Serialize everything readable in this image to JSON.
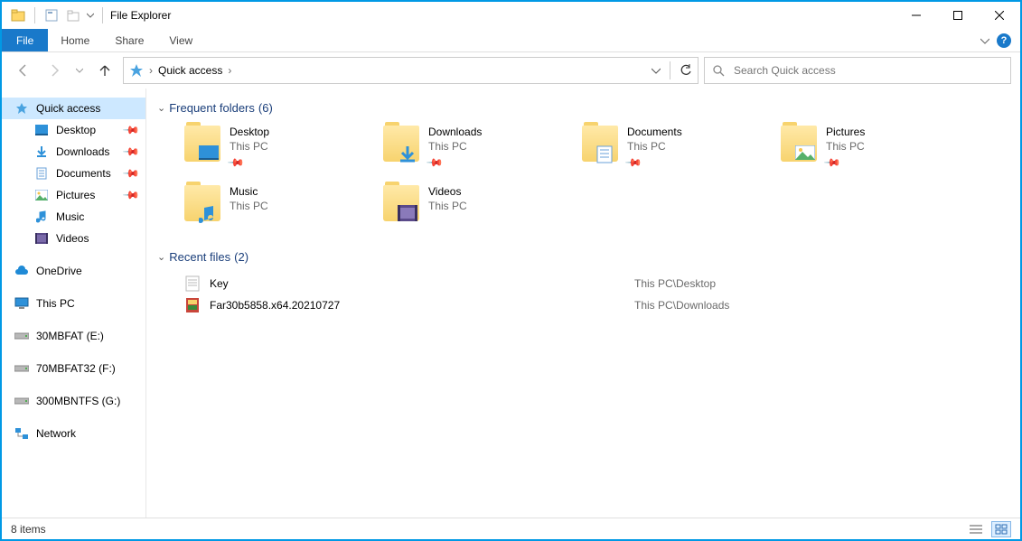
{
  "window": {
    "title": "File Explorer"
  },
  "ribbon": {
    "file": "File",
    "tabs": [
      "Home",
      "Share",
      "View"
    ]
  },
  "breadcrumb": {
    "root": "Quick access"
  },
  "search": {
    "placeholder": "Search Quick access"
  },
  "sidebar": {
    "quick_access": "Quick access",
    "pinned": [
      {
        "label": "Desktop",
        "icon": "desktop"
      },
      {
        "label": "Downloads",
        "icon": "download"
      },
      {
        "label": "Documents",
        "icon": "document"
      },
      {
        "label": "Pictures",
        "icon": "pictures"
      }
    ],
    "unpinned": [
      {
        "label": "Music",
        "icon": "music"
      },
      {
        "label": "Videos",
        "icon": "video"
      }
    ],
    "onedrive": "OneDrive",
    "this_pc": "This PC",
    "drives": [
      {
        "label": "30MBFAT (E:)"
      },
      {
        "label": "70MBFAT32 (F:)"
      },
      {
        "label": "300MBNTFS (G:)"
      }
    ],
    "network": "Network"
  },
  "groups": {
    "frequent": {
      "title": "Frequent folders",
      "count": "(6)"
    },
    "recent": {
      "title": "Recent files",
      "count": "(2)"
    }
  },
  "frequent_folders": [
    {
      "name": "Desktop",
      "sub": "This PC",
      "overlay": "desktop",
      "pinned": true
    },
    {
      "name": "Downloads",
      "sub": "This PC",
      "overlay": "download",
      "pinned": true
    },
    {
      "name": "Documents",
      "sub": "This PC",
      "overlay": "document",
      "pinned": true
    },
    {
      "name": "Pictures",
      "sub": "This PC",
      "overlay": "pictures",
      "pinned": true
    },
    {
      "name": "Music",
      "sub": "This PC",
      "overlay": "music",
      "pinned": false
    },
    {
      "name": "Videos",
      "sub": "This PC",
      "overlay": "video",
      "pinned": false
    }
  ],
  "recent_files": [
    {
      "name": "Key",
      "path": "This PC\\Desktop",
      "icon": "text"
    },
    {
      "name": "Far30b5858.x64.20210727",
      "path": "This PC\\Downloads",
      "icon": "archive"
    }
  ],
  "status": {
    "items": "8 items"
  }
}
